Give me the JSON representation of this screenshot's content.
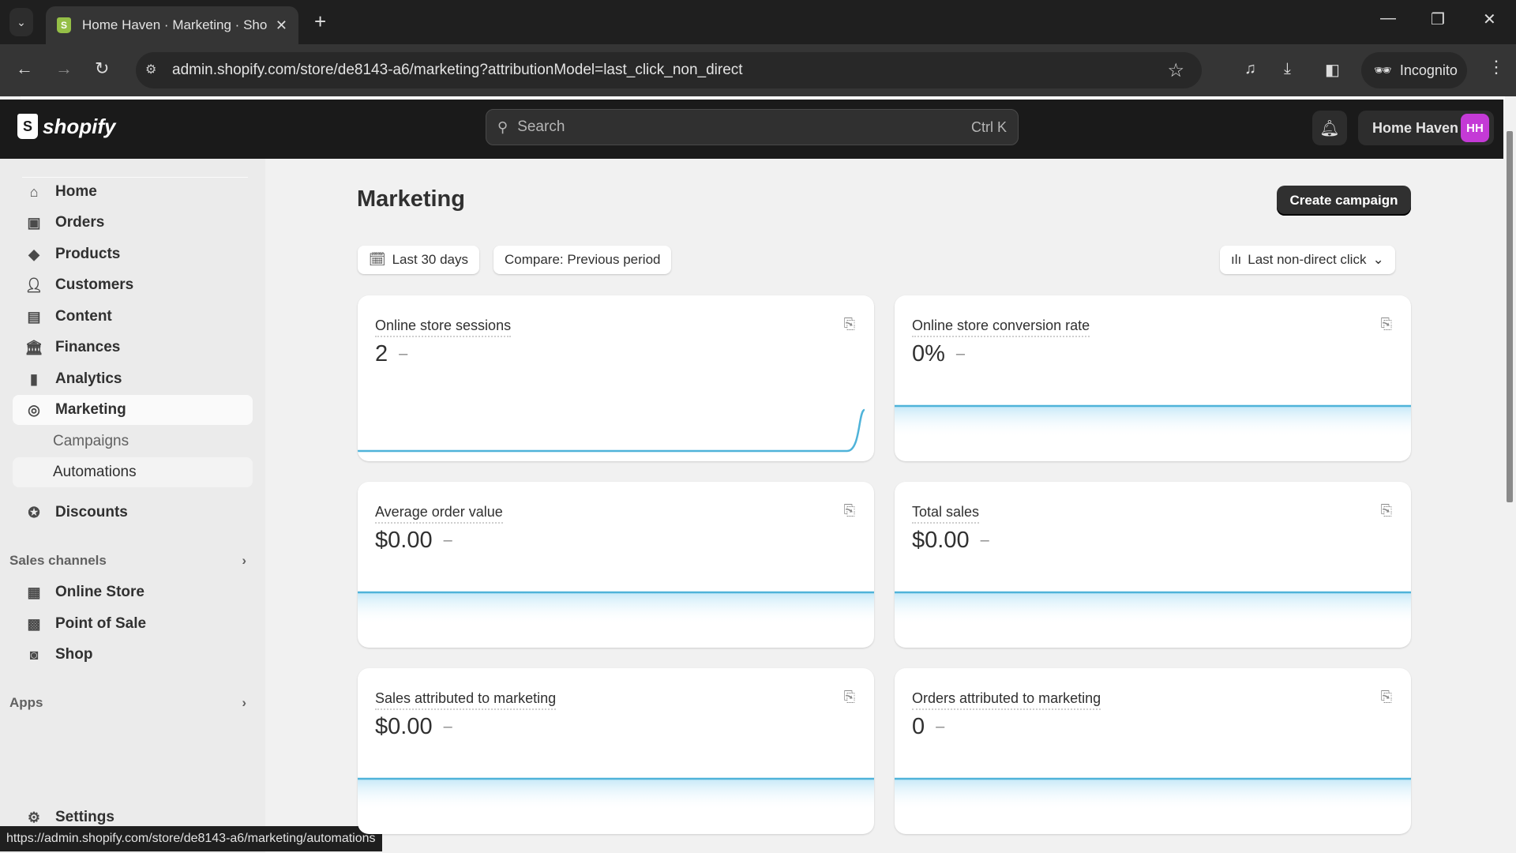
{
  "browser": {
    "tab_title": "Home Haven · Marketing · Shop",
    "tab_favicon": "shopify-icon",
    "url": "admin.shopify.com/store/de8143-a6/marketing?attributionModel=last_click_non_direct",
    "incognito_label": "Incognito",
    "status_url": "https://admin.shopify.com/store/de8143-a6/marketing/automations"
  },
  "topbar": {
    "logo_text": "shopify",
    "search_placeholder": "Search",
    "search_shortcut": "Ctrl K",
    "store_name": "Home Haven",
    "avatar_initials": "HH",
    "avatar_color": "#c43ad6"
  },
  "sidebar": {
    "items": [
      {
        "label": "Home",
        "icon": "home-icon"
      },
      {
        "label": "Orders",
        "icon": "inbox-icon"
      },
      {
        "label": "Products",
        "icon": "tag-icon"
      },
      {
        "label": "Customers",
        "icon": "person-icon"
      },
      {
        "label": "Content",
        "icon": "image-icon"
      },
      {
        "label": "Finances",
        "icon": "bank-icon"
      },
      {
        "label": "Analytics",
        "icon": "bar-chart-icon"
      },
      {
        "label": "Marketing",
        "icon": "target-icon",
        "active": true
      },
      {
        "label": "Campaigns"
      },
      {
        "label": "Automations",
        "hovered": true
      },
      {
        "label": "Discounts",
        "icon": "discount-icon"
      }
    ],
    "sales_channels_label": "Sales channels",
    "sales_channels": [
      {
        "label": "Online Store",
        "icon": "store-icon"
      },
      {
        "label": "Point of Sale",
        "icon": "pos-icon"
      },
      {
        "label": "Shop",
        "icon": "shop-icon"
      }
    ],
    "apps_label": "Apps",
    "settings_label": "Settings"
  },
  "main": {
    "title": "Marketing",
    "create_campaign_label": "Create campaign",
    "date_range_label": "Last 30 days",
    "compare_label": "Compare: Previous period",
    "attribution_label": "Last non-direct click",
    "accent_color": "#4fb3d9"
  },
  "chart_data": [
    {
      "type": "line",
      "title": "Online store sessions",
      "value": "2",
      "change": "–",
      "values": [
        0,
        0,
        0,
        0,
        0,
        0,
        0,
        0,
        0,
        0,
        0,
        0,
        0,
        0,
        0,
        0,
        0,
        0,
        0,
        0,
        0,
        0,
        0,
        0,
        0,
        0,
        0,
        0,
        0,
        2
      ]
    },
    {
      "type": "area",
      "title": "Online store conversion rate",
      "value": "0%",
      "change": "–",
      "values": [
        0,
        0,
        0,
        0,
        0,
        0,
        0,
        0,
        0,
        0,
        0,
        0,
        0,
        0,
        0,
        0,
        0,
        0,
        0,
        0,
        0,
        0,
        0,
        0,
        0,
        0,
        0,
        0,
        0,
        0
      ]
    },
    {
      "type": "area",
      "title": "Average order value",
      "value": "$0.00",
      "change": "–",
      "values": [
        0,
        0,
        0,
        0,
        0,
        0,
        0,
        0,
        0,
        0,
        0,
        0,
        0,
        0,
        0,
        0,
        0,
        0,
        0,
        0,
        0,
        0,
        0,
        0,
        0,
        0,
        0,
        0,
        0,
        0
      ]
    },
    {
      "type": "area",
      "title": "Total sales",
      "value": "$0.00",
      "change": "–",
      "values": [
        0,
        0,
        0,
        0,
        0,
        0,
        0,
        0,
        0,
        0,
        0,
        0,
        0,
        0,
        0,
        0,
        0,
        0,
        0,
        0,
        0,
        0,
        0,
        0,
        0,
        0,
        0,
        0,
        0,
        0
      ]
    },
    {
      "type": "area",
      "title": "Sales attributed to marketing",
      "value": "$0.00",
      "change": "–",
      "values": [
        0,
        0,
        0,
        0,
        0,
        0,
        0,
        0,
        0,
        0,
        0,
        0,
        0,
        0,
        0,
        0,
        0,
        0,
        0,
        0,
        0,
        0,
        0,
        0,
        0,
        0,
        0,
        0,
        0,
        0
      ]
    },
    {
      "type": "area",
      "title": "Orders attributed to marketing",
      "value": "0",
      "change": "–",
      "values": [
        0,
        0,
        0,
        0,
        0,
        0,
        0,
        0,
        0,
        0,
        0,
        0,
        0,
        0,
        0,
        0,
        0,
        0,
        0,
        0,
        0,
        0,
        0,
        0,
        0,
        0,
        0,
        0,
        0,
        0
      ]
    }
  ]
}
